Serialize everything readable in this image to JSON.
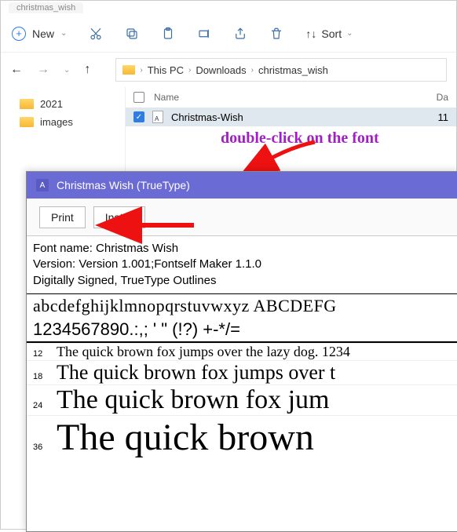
{
  "explorer": {
    "tab_label": "christmas_wish",
    "toolbar": {
      "new_label": "New",
      "sort_label": "Sort"
    },
    "breadcrumb": [
      "This PC",
      "Downloads",
      "christmas_wish"
    ],
    "tree": [
      {
        "label": "2021"
      },
      {
        "label": "images"
      }
    ],
    "list": {
      "cols": {
        "name": "Name",
        "date": "Da"
      },
      "rows": [
        {
          "name": "Christmas-Wish",
          "date_trunc": "11"
        }
      ]
    }
  },
  "annotation": {
    "text": "double-click on the font"
  },
  "fontviewer": {
    "title": "Christmas Wish (TrueType)",
    "buttons": {
      "print": "Print",
      "install": "Install"
    },
    "meta": {
      "fontname": "Font name: Christmas Wish",
      "version": "Version: Version 1.001;Fontself Maker 1.1.0",
      "signed": "Digitally Signed, TrueType Outlines"
    },
    "alpha": "abcdefghijklmnopqrstuvwxyz ABCDEFG",
    "nums": "1234567890.:,; ' \" (!?) +-*/=",
    "lines": [
      {
        "size": "12",
        "text": "The quick brown fox jumps over the lazy dog. 1234"
      },
      {
        "size": "18",
        "text": "The quick brown fox jumps over t"
      },
      {
        "size": "24",
        "text": "The quick brown fox jum"
      },
      {
        "size": "36",
        "text": "The quick brown"
      }
    ]
  }
}
